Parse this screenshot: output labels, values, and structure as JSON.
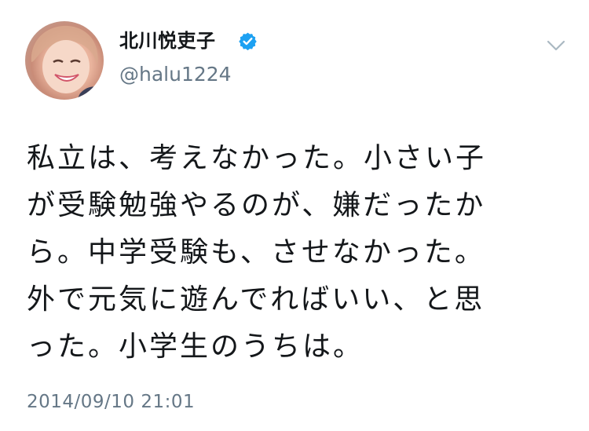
{
  "tweet": {
    "user": {
      "display_name": "北川悦吏子",
      "handle": "@halu1224",
      "verified": true,
      "avatar_icon": "avatar-photo"
    },
    "menu_icon": "chevron-down-icon",
    "text_lines": [
      "私立は、考えなかった。小さい子",
      "が受験勉強やるのが、嫌だったか",
      "ら。中学受験も、させなかった。",
      "外で元気に遊んでればいい、と思",
      "った。小学生のうちは。"
    ],
    "timestamp": "2014/09/10 21:01"
  },
  "colors": {
    "text_primary": "#14171a",
    "text_secondary": "#657786",
    "verified_blue": "#1da1f2",
    "caret_gray": "#aab8c2"
  }
}
